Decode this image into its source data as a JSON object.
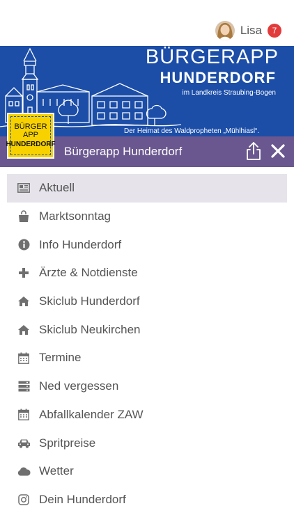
{
  "user": {
    "name": "Lisa",
    "notification_count": "7"
  },
  "banner": {
    "title": "BÜRGERAPP",
    "subtitle": "HUNDERDORF",
    "region": "im Landkreis Straubing-Bogen",
    "motto": "Der Heimat des Waldpropheten „Mühlhiasl“."
  },
  "logo": {
    "line1": "BÜRGER",
    "line2": "APP",
    "line3": "HUNDERDORF"
  },
  "header": {
    "title": "Bürgerapp Hunderdorf"
  },
  "colors": {
    "banner": "#1c4ea8",
    "header": "#6a578f",
    "active_row": "#e6e4ea",
    "icon": "#6f6f6f",
    "badge": "#e23b3b",
    "logo": "#f7d200"
  },
  "menu": [
    {
      "label": "Aktuell",
      "icon": "newspaper-icon",
      "active": true
    },
    {
      "label": "Marktsonntag",
      "icon": "shopping-bag-icon"
    },
    {
      "label": "Info Hunderdorf",
      "icon": "info-icon"
    },
    {
      "label": "Ärzte & Notdienste",
      "icon": "plus-icon"
    },
    {
      "label": "Skiclub Hunderdorf",
      "icon": "home-icon"
    },
    {
      "label": "Skiclub Neukirchen",
      "icon": "home-icon"
    },
    {
      "label": "Termine",
      "icon": "calendar-icon"
    },
    {
      "label": "Ned vergessen",
      "icon": "server-icon"
    },
    {
      "label": "Abfallkalender ZAW",
      "icon": "calendar-icon"
    },
    {
      "label": "Spritpreise",
      "icon": "car-icon"
    },
    {
      "label": "Wetter",
      "icon": "cloud-icon"
    },
    {
      "label": "Dein Hunderdorf",
      "icon": "instagram-icon"
    }
  ]
}
